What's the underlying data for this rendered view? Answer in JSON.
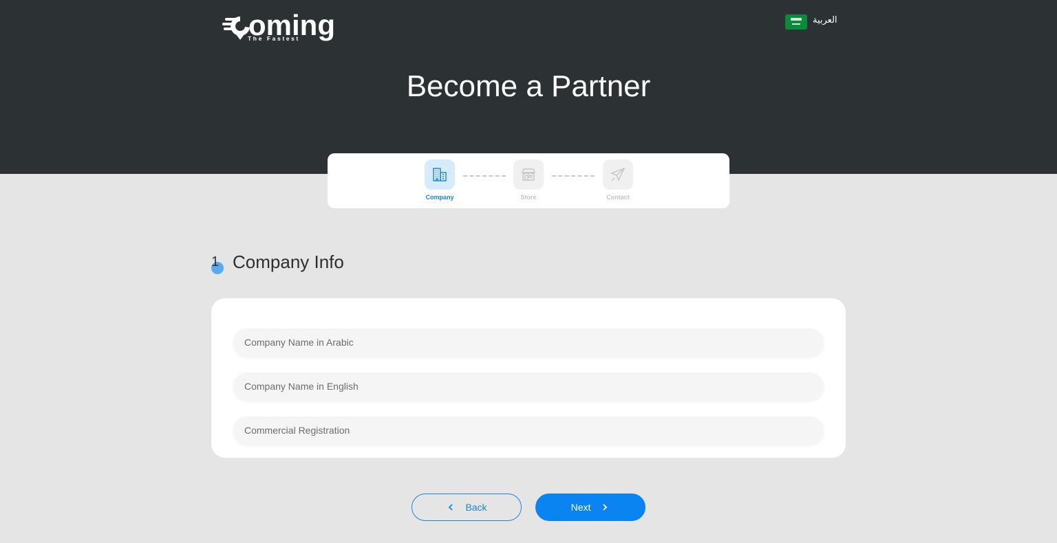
{
  "header": {
    "logo": {
      "word": "oming",
      "tagline": "The Fastest"
    },
    "language": {
      "label": "العربية",
      "flag_icon": "saudi-flag-icon"
    },
    "title": "Become a Partner"
  },
  "stepper": {
    "steps": [
      {
        "label": "Company",
        "icon": "building-icon",
        "active": true
      },
      {
        "label": "Store",
        "icon": "store-icon",
        "active": false
      },
      {
        "label": "Contact",
        "icon": "paper-plane-icon",
        "active": false
      }
    ]
  },
  "section": {
    "number": "1",
    "title": "Company Info"
  },
  "form": {
    "fields": [
      {
        "placeholder": "Company Name in Arabic",
        "value": ""
      },
      {
        "placeholder": "Company Name in English",
        "value": ""
      },
      {
        "placeholder": "Commercial Registration",
        "value": ""
      }
    ]
  },
  "actions": {
    "back_label": "Back",
    "next_label": "Next"
  },
  "colors": {
    "header_bg": "#2c3134",
    "accent": "#0a84f0",
    "page_bg": "#e5e5e5"
  }
}
